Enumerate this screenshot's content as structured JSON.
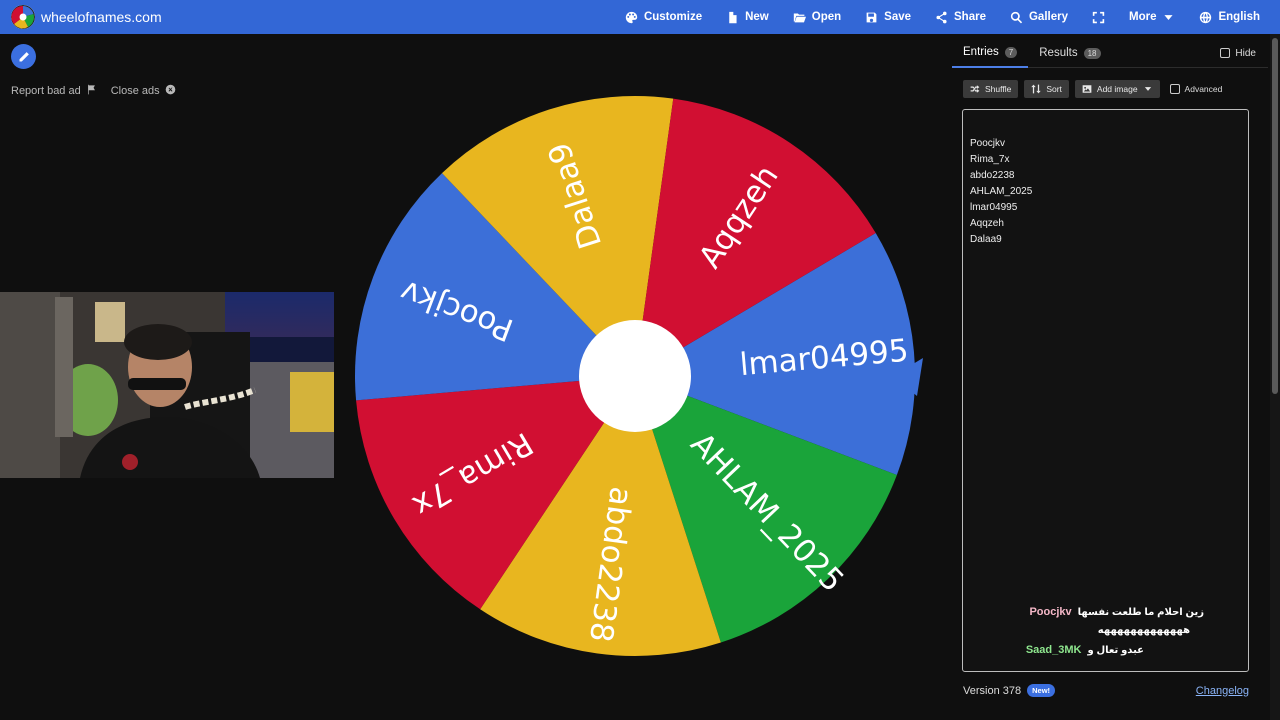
{
  "header": {
    "site_name": "wheelofnames.com",
    "nav": [
      {
        "label": "Customize",
        "icon": "palette-icon"
      },
      {
        "label": "New",
        "icon": "file-icon"
      },
      {
        "label": "Open",
        "icon": "folder-open-icon"
      },
      {
        "label": "Save",
        "icon": "save-icon"
      },
      {
        "label": "Share",
        "icon": "share-icon"
      },
      {
        "label": "Gallery",
        "icon": "search-icon"
      },
      {
        "label": "",
        "icon": "fullscreen-icon"
      },
      {
        "label": "More",
        "icon": "chevron-down-icon"
      },
      {
        "label": "English",
        "icon": "globe-icon"
      }
    ]
  },
  "ads": {
    "report_label": "Report bad ad",
    "close_label": "Close ads"
  },
  "wheel": {
    "segments": [
      {
        "label": "lmar04995",
        "color": "#3c6fd8"
      },
      {
        "label": "AHLAM_2025",
        "color": "#1aa43a"
      },
      {
        "label": "abdo2238",
        "color": "#e8b61f"
      },
      {
        "label": "Rima_7x",
        "color": "#d10f32"
      },
      {
        "label": "Poocjkv",
        "color": "#3c6fd8"
      },
      {
        "label": "Dalaa9",
        "color": "#e8b61f"
      },
      {
        "label": "Aqqzeh",
        "color": "#d10f32"
      }
    ],
    "pointer_color": "#3c6fd8"
  },
  "panel": {
    "tabs": [
      {
        "label": "Entries",
        "count": "7"
      },
      {
        "label": "Results",
        "count": "18"
      }
    ],
    "hide_label": "Hide",
    "toolbar": {
      "shuffle": "Shuffle",
      "sort": "Sort",
      "add_image": "Add image",
      "advanced": "Advanced"
    },
    "entries": [
      "Poocjkv",
      "Rima_7x",
      "abdo2238",
      "AHLAM_2025",
      "lmar04995",
      "Aqqzeh",
      "Dalaa9"
    ],
    "chat": [
      {
        "user": "Poocjkv",
        "color": "#f5b8c8",
        "message": "زين احلام ما طلعت نفسها"
      },
      {
        "user": "",
        "color": "#ffffff",
        "message": "هههههههههههههه"
      },
      {
        "user": "Saad_3MK",
        "color": "#8ee68e",
        "message": "عبدو تعال و"
      }
    ],
    "version": "Version 378",
    "new_badge": "New!",
    "changelog": "Changelog"
  }
}
